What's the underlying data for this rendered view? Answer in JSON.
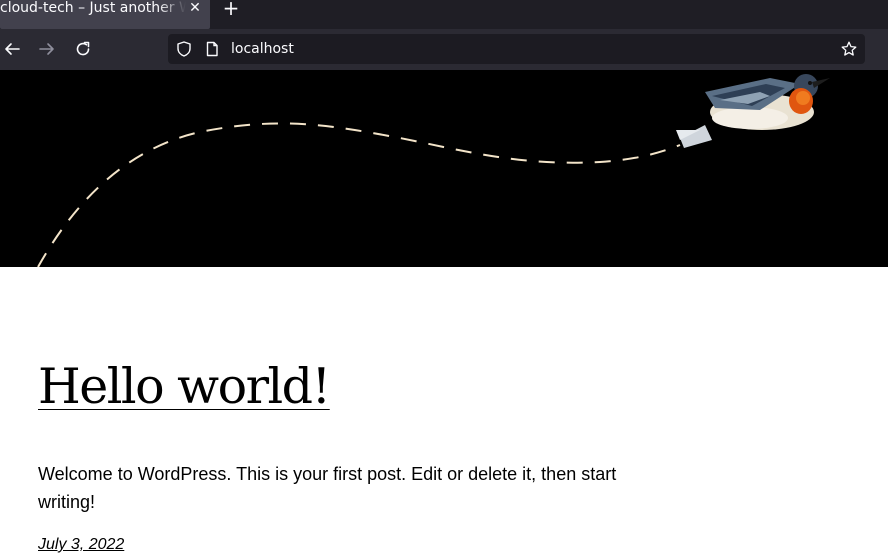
{
  "browser": {
    "tab_title": "cloud-tech – Just another WordPress site",
    "tab_close_icon": "close-icon",
    "new_tab_symbol": "+",
    "url": "localhost",
    "colors": {
      "tabbar": "#1f1e25",
      "active_tab": "#42414d",
      "navbar": "#2b2a33",
      "urlbar": "#1c1b22",
      "text": "#fbfbfe"
    }
  },
  "header": {
    "background": "#000000",
    "illustration": "hummingbird-with-dashed-flight-path"
  },
  "post": {
    "title": "Hello world!",
    "body": "Welcome to WordPress. This is your first post. Edit or delete it, then start writing!",
    "date": "July 3, 2022"
  }
}
